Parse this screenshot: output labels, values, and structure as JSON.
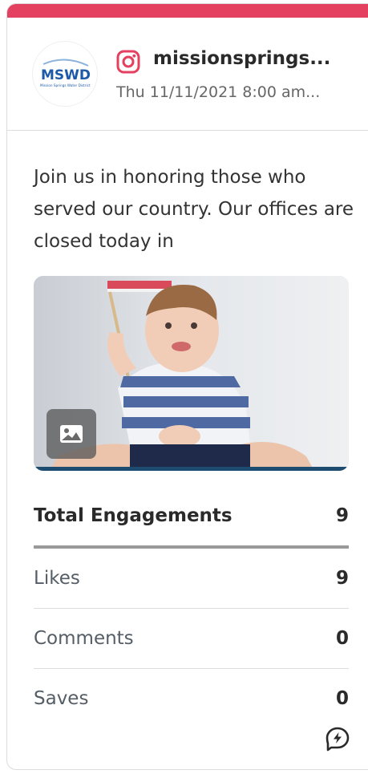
{
  "post": {
    "account_name": "missionsprings...",
    "date": "Thu 11/11/2021 8:00 am...",
    "caption": "Join us in honoring those who served our country. Our offices are closed today in",
    "network_icon": "instagram-icon",
    "avatar_text": "MSWD",
    "avatar_subtext": "Mission Springs Water District",
    "media_type_icon": "image-icon"
  },
  "stats": {
    "total_label": "Total Engagements",
    "total_value": "9",
    "rows": [
      {
        "label": "Likes",
        "value": "9"
      },
      {
        "label": "Comments",
        "value": "0"
      },
      {
        "label": "Saves",
        "value": "0"
      }
    ]
  },
  "footer": {
    "boost_icon": "boost-icon"
  },
  "colors": {
    "instagram_accent": "#e4405f",
    "avatar_blue": "#1d5aa8"
  }
}
